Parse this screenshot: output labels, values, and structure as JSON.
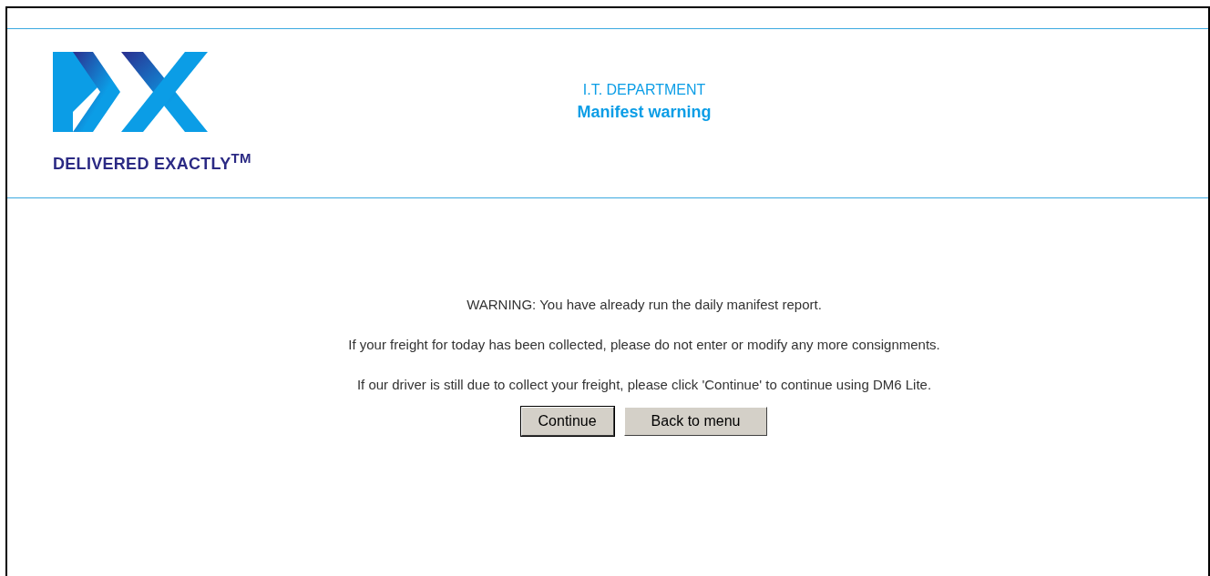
{
  "logo": {
    "tagline": "DELIVERED EXACTLY$^{TM}$"
  },
  "header": {
    "department": "I.T. DEPARTMENT",
    "title": "Manifest warning"
  },
  "messages": [
    "WARNING: You have already run the daily manifest report.",
    "If your freight for today has been collected, please do not enter or modify any more consignments.",
    "If our driver is still due to collect your freight, please click 'Continue' to continue using DM6 Lite."
  ],
  "buttons": [
    {
      "label": "Continue",
      "default": true
    },
    {
      "label": "Back to menu",
      "default": false
    }
  ]
}
